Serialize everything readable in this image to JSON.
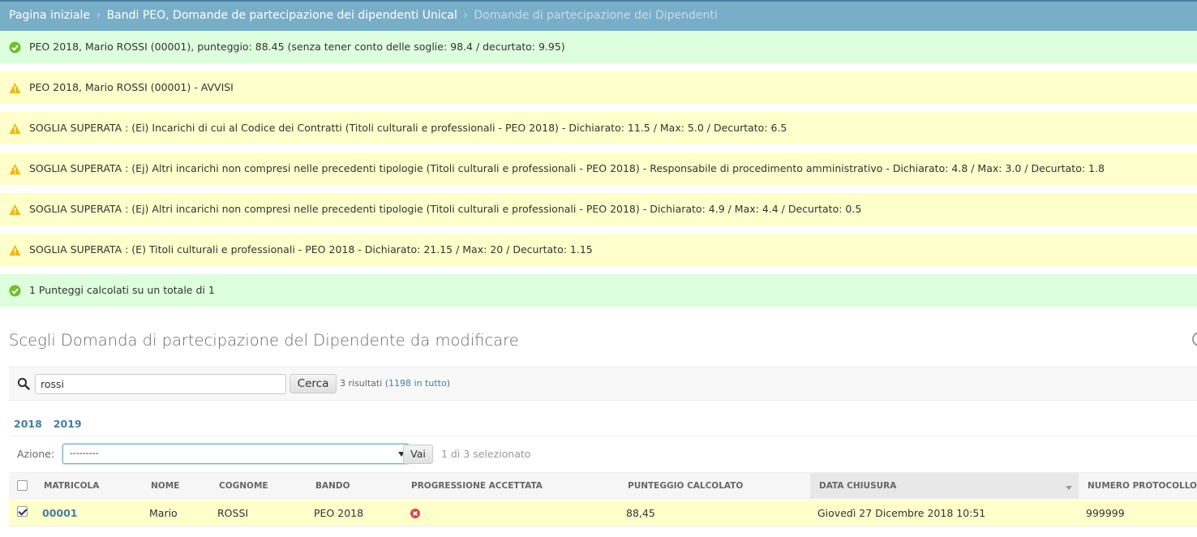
{
  "breadcrumbs": {
    "home": "Pagina iniziale",
    "app": "Bandi PEO, Domande de partecipazione dei dipendenti Unical",
    "current": "Domande di partecipazione dei Dipendenti",
    "separator": "›"
  },
  "messages": [
    {
      "level": "success",
      "icon": "check-circle-icon",
      "text": "PEO 2018, Mario ROSSI (00001), punteggio: 88.45 (senza tener conto delle soglie: 98.4 / decurtato: 9.95)"
    },
    {
      "level": "warning",
      "icon": "warning-triangle-icon",
      "text": "PEO 2018, Mario ROSSI (00001) - AVVISI"
    },
    {
      "level": "warning",
      "icon": "warning-triangle-icon",
      "text": "SOGLIA SUPERATA : (Ei) Incarichi di cui al Codice dei Contratti (Titoli culturali e professionali - PEO 2018) - Dichiarato: 11.5 / Max: 5.0 / Decurtato: 6.5"
    },
    {
      "level": "warning",
      "icon": "warning-triangle-icon",
      "text": "SOGLIA SUPERATA : (Ej) Altri incarichi non compresi nelle precedenti tipologie (Titoli culturali e professionali - PEO 2018) - Responsabile di procedimento amministrativo - Dichiarato: 4.8 / Max: 3.0 / Decurtato: 1.8"
    },
    {
      "level": "warning",
      "icon": "warning-triangle-icon",
      "text": "SOGLIA SUPERATA : (Ej) Altri incarichi non compresi nelle precedenti tipologie (Titoli culturali e professionali - PEO 2018) - Dichiarato: 4.9 / Max: 4.4 / Decurtato: 0.5"
    },
    {
      "level": "warning",
      "icon": "warning-triangle-icon",
      "text": "SOGLIA SUPERATA : (E) Titoli culturali e professionali - PEO 2018 - Dichiarato: 21.15 / Max: 20 / Decurtato: 1.15"
    },
    {
      "level": "success",
      "icon": "check-circle-icon",
      "text": "1 Punteggi calcolati su un totale di 1"
    }
  ],
  "page_title": "Scegli Domanda di partecipazione del Dipendente da modificare",
  "search": {
    "value": "rossi",
    "button_label": "Cerca",
    "result_prefix": "3 risultati (",
    "result_link": "1198 in tutto",
    "result_suffix": ")"
  },
  "date_hierarchy": [
    "2018",
    "2019"
  ],
  "actions": {
    "label": "Azione:",
    "selected": "---------",
    "go_label": "Vai",
    "selection_count": "1 di 3 selezionato"
  },
  "table": {
    "columns": [
      "MATRICOLA",
      "NOME",
      "COGNOME",
      "BANDO",
      "PROGRESSIONE ACCETTATA",
      "PUNTEGGIO CALCOLATO",
      "DATA CHIUSURA",
      "NUMERO PROTOCOLLO"
    ],
    "sorted_column": "DATA CHIUSURA",
    "rows": [
      {
        "checked": true,
        "matricola": "00001",
        "nome": "Mario",
        "cognome": "ROSSI",
        "bando": "PEO 2018",
        "progressione_accettata": "no-icon",
        "punteggio": "88,45",
        "data_chiusura": "Giovedì 27 Dicembre 2018 10:51",
        "protocollo": "999999"
      }
    ]
  },
  "colors": {
    "breadcrumb_bg": "#79aec8",
    "success_bg": "#ddffdd",
    "warning_bg": "#ffffcc",
    "link": "#447e9b",
    "success_icon": "#70bf2b",
    "warning_icon": "#efb80b",
    "error_icon": "#dd4646"
  }
}
